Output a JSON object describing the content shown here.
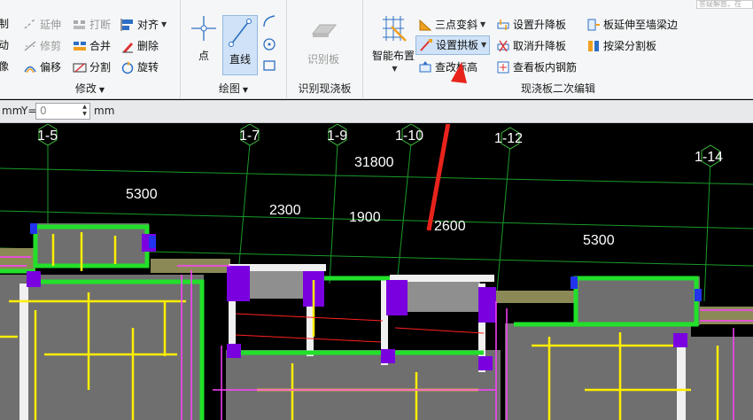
{
  "search_placeholder": "答疑解惑，在",
  "modify": {
    "label": "修改",
    "items": [
      "复制",
      "延伸",
      "打断",
      "对齐",
      "移动",
      "修剪",
      "合并",
      "删除",
      "镜像",
      "偏移",
      "分割",
      "旋转"
    ]
  },
  "draw": {
    "label": "绘图",
    "point": "点",
    "line": "直线"
  },
  "identify": {
    "label": "识别现浇板",
    "button": "识别板"
  },
  "edit": {
    "label": "现浇板二次编辑",
    "smart": "智能布置",
    "three_point_slope": "三点变斜",
    "set_arch": "设置拱板",
    "check_elev": "查改标高",
    "set_lift": "设置升降板",
    "cancel_lift": "取消升降板",
    "view_rebar": "查看板内钢筋",
    "extend_wall": "板延伸至墙梁边",
    "split_by_beam": "按梁分割板"
  },
  "coord": {
    "unit1": "mm",
    "y_label": "Y=",
    "y_value": "0",
    "unit2": "mm"
  },
  "axes": [
    "1-5",
    "1-7",
    "1-9",
    "1-10",
    "1-12",
    "1-14"
  ],
  "dims": [
    "31800",
    "5300",
    "2300",
    "1900",
    "2600",
    "5300"
  ],
  "colors": {
    "arrow": "#e8231c",
    "ribbon": "#f5f6f7",
    "canvas": "#000000"
  }
}
